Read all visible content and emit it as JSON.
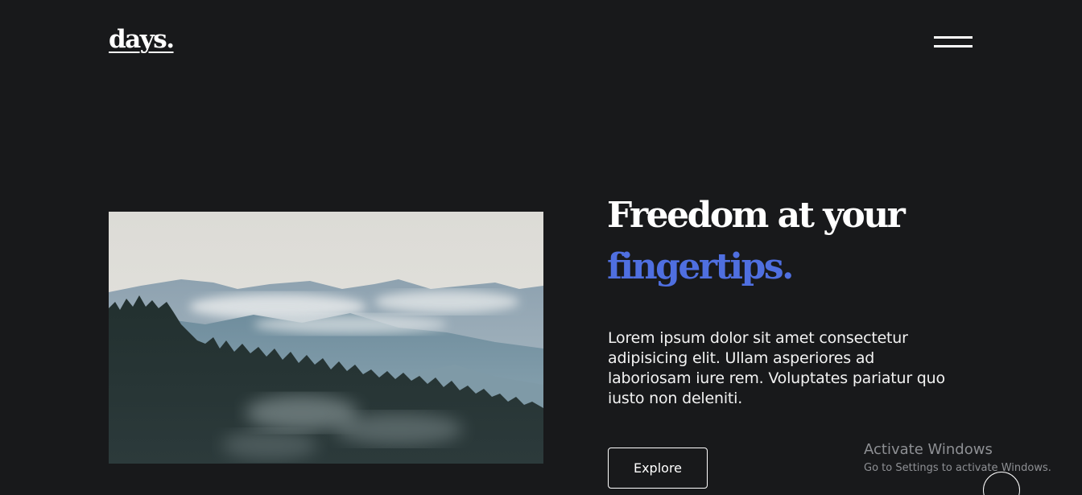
{
  "header": {
    "logo": "days."
  },
  "hero": {
    "headline_line1": "Freedom at your",
    "headline_accent": "fingertips.",
    "body": "Lorem ipsum dolor sit amet consectetur adipisicing elit. Ullam asperiores ad laboriosam iure rem. Voluptates pariatur quo iusto non deleniti.",
    "cta_label": "Explore",
    "image_icon": "misty-mountain-forest-photo"
  },
  "watermark": {
    "title": "Activate Windows",
    "subtitle": "Go to Settings to activate Windows."
  },
  "colors": {
    "background": "#18191b",
    "accent": "#4f6fe0",
    "text": "#ffffff"
  },
  "icons": {
    "menu": "hamburger-menu-icon",
    "scroll": "scroll-circle-icon"
  }
}
